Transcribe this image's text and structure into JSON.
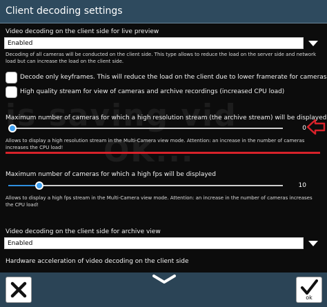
{
  "window": {
    "title": "Client decoding settings"
  },
  "live_decoding": {
    "label": "Video decoding on the client side for live preview",
    "selected": "Enabled",
    "hint": "Decoding of all cameras will be conducted on the client side. This type allows to reduce the load on the server side and network load but can increase the load on the client side."
  },
  "keyframes": {
    "label": "Decode only keyframes. This will reduce the load on the client due to lower framerate for cameras view",
    "checked": false
  },
  "hq_stream": {
    "label": "High quality stream for view of cameras and archive  recordings (increased CPU load)",
    "checked": false
  },
  "watermark": {
    "line1": "is saving vid",
    "line2": "OK..."
  },
  "hires_cameras": {
    "label": "Maximum number of cameras for which a high resolution stream (the archive stream) will be displayed",
    "value": "0",
    "level": 0,
    "hint": "Allows to display a high resolution stream in the Multi-Camera view mode. Attention: an increase in the number of cameras increases the CPU load!"
  },
  "hifps_cameras": {
    "label": "Maximum number of cameras for which a high fps will be displayed",
    "value": "10",
    "level": 0.1,
    "hint": "Allows to display a high fps stream in the Multi-Camera view mode. Attention: an increase in the number of cameras increases the CPU load!"
  },
  "archive_decoding": {
    "label": "Video decoding on the client side for archive view",
    "selected": "Enabled"
  },
  "hw_accel": {
    "label": "Hardware acceleration of video decoding on the client side"
  },
  "buttons": {
    "ok_label": "ok"
  },
  "icons": {
    "cancel": "close-icon",
    "ok": "check-icon",
    "scroll": "chevron-down-icon",
    "annotation": "red-arrow-icon"
  },
  "colors": {
    "titlebar": "#2e4a5e",
    "accent": "#2f8fe0",
    "annotation": "#d8222a"
  }
}
